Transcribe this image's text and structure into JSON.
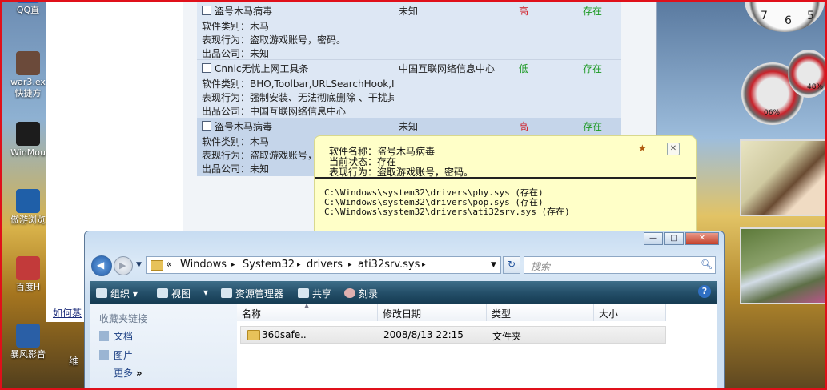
{
  "desktop": {
    "icons": [
      {
        "label": "QQ直",
        "color": "#2c68b8"
      },
      {
        "label": "war3.ex",
        "label2": "快捷方",
        "color": "#6b4a3a"
      },
      {
        "label": "WinMou",
        "color": "#1c1c1c"
      },
      {
        "label": "傲游浏览",
        "color": "#1f5fa8"
      },
      {
        "label": "百度H",
        "color": "#c23a3a"
      },
      {
        "label": "暴风影音",
        "color": "#2a5fa6"
      }
    ],
    "partial_label": "维"
  },
  "bg_app": {
    "left_link": "如何蒸",
    "rows": [
      {
        "name": "盗号木马病毒",
        "company": "未知",
        "risk": "高",
        "risk_color": "#d0141c",
        "status": "存在",
        "details": [
          "软件类别：木马",
          "表现行为：盗取游戏账号，密码。",
          "出品公司：未知"
        ]
      },
      {
        "name": "Cnnic无忧上网工具条",
        "company": "中国互联网络信息中心",
        "risk": "低",
        "risk_color": "#1d9a24",
        "status": "存在",
        "details": [
          "软件类别：BHO,Toolbar,URLSearchHook,IE右键",
          "表现行为：强制安装、无法彻底删除 、干扰其",
          "出品公司：中国互联网络信息中心"
        ]
      },
      {
        "name": "盗号木马病毒",
        "company": "未知",
        "risk": "高",
        "risk_color": "#d0141c",
        "status": "存在",
        "details": [
          "软件类别：木马",
          "表现行为：盗取游戏账号，密码。",
          "出品公司：未知"
        ]
      }
    ]
  },
  "tooltip": {
    "info": [
      "软件名称：盗号木马病毒",
      "当前状态：存在",
      "表现行为：盗取游戏账号，密码。"
    ],
    "files": [
      "C:\\Windows\\system32\\drivers\\phy.sys  (存在)",
      "C:\\Windows\\system32\\drivers\\pop.sys  (存在)",
      "C:\\Windows\\system32\\drivers\\ati32srv.sys  (存在)"
    ]
  },
  "gadgets": {
    "clock_nums": [
      "7",
      "6",
      "5"
    ],
    "meter1": "06%",
    "meter2": "48%"
  },
  "explorer": {
    "caption_buttons": [
      "—",
      "□",
      "✕"
    ],
    "address": [
      "«",
      "Windows",
      "▸",
      "System32",
      "▸",
      "drivers",
      "▸",
      "ati32srv.sys",
      "▸"
    ],
    "search_placeholder": "搜索",
    "toolbar": [
      "组织",
      "视图",
      "资源管理器",
      "共享",
      "刻录"
    ],
    "nav_title": "收藏夹链接",
    "nav_items": [
      "文档",
      "图片",
      "更多"
    ],
    "nav_more_arrow": "»",
    "columns": [
      "名称",
      "修改日期",
      "类型",
      "大小"
    ],
    "files": [
      {
        "name": "360safe..",
        "date": "2008/8/13 22:15",
        "type": "文件夹",
        "size": ""
      }
    ]
  }
}
